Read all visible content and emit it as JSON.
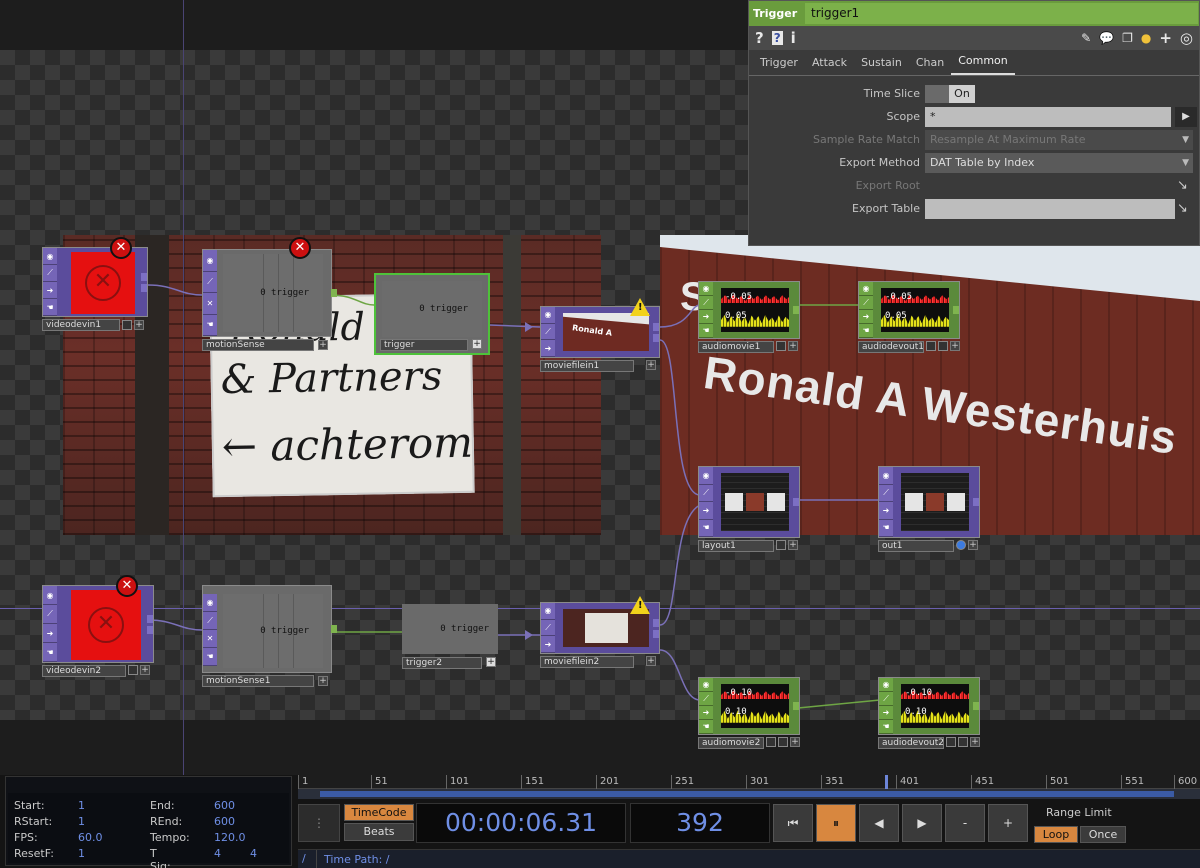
{
  "params": {
    "op_type": "Trigger",
    "op_name": "trigger1",
    "tools": {
      "help": "?",
      "python_help": "?",
      "info": "i"
    },
    "tabs": [
      "Trigger",
      "Attack",
      "Sustain",
      "Chan",
      "Common"
    ],
    "active_tab": "Common",
    "time_slice": {
      "label": "Time Slice",
      "value": "On"
    },
    "scope": {
      "label": "Scope",
      "value": "*"
    },
    "sample_rate_match": {
      "label": "Sample Rate Match",
      "value": "Resample At Maximum Rate"
    },
    "export_method": {
      "label": "Export Method",
      "value": "DAT Table by Index"
    },
    "export_root": {
      "label": "Export Root",
      "value": ""
    },
    "export_table": {
      "label": "Export Table",
      "value": ""
    }
  },
  "nodes": {
    "videodevin1": "videodevin1",
    "motionSense": "motionSense",
    "trigger": "trigger",
    "moviefilein1": "moviefilein1",
    "audiomovie1": "audiomovie1",
    "audiodevout1": "audiodevout1",
    "layout1": "layout1",
    "out1": "out1",
    "videodevin2": "videodevin2",
    "motionSense1": "motionSense1",
    "trigger2": "trigger2",
    "moviefilein2": "moviefilein2",
    "audiomovie2": "audiomovie2",
    "audiodevout2": "audiodevout2",
    "trigger_value": "0 trigger",
    "chop_val_a": "-0.05",
    "chop_val_b": "0.05",
    "chop_val_c": "-0.10",
    "chop_val_d": "0.10"
  },
  "background": {
    "sign_line1": "Ronald Ro",
    "sign_line2": "& Partners",
    "sign_line3": "← achterom",
    "building_s": "S",
    "building_text": "Ronald A Westerhuis"
  },
  "timeline": {
    "start_label": "Start:",
    "start": "1",
    "rstart_label": "RStart:",
    "rstart": "1",
    "fps_label": "FPS:",
    "fps": "60.0",
    "resetf_label": "ResetF:",
    "resetf": "1",
    "end_label": "End:",
    "end": "600",
    "rend_label": "REnd:",
    "rend": "600",
    "tempo_label": "Tempo:",
    "tempo": "120.0",
    "tsig_label": "T Sig:",
    "tsig_a": "4",
    "tsig_b": "4",
    "ruler": [
      "1",
      "51",
      "101",
      "151",
      "201",
      "251",
      "301",
      "351",
      "401",
      "451",
      "501",
      "551",
      "600"
    ],
    "timecode_btn": "TimeCode",
    "beats_btn": "Beats",
    "timecode": "00:00:06.31",
    "frame": "392",
    "range_limit": "Range Limit",
    "loop": "Loop",
    "once": "Once",
    "path_root": "/",
    "time_path": "Time Path: /",
    "grip": "⋮",
    "btn_rewind": "⏮",
    "btn_pause": "⏸",
    "btn_back": "◀",
    "btn_fwd": "▶",
    "btn_minus": "-",
    "btn_plus": "+"
  }
}
